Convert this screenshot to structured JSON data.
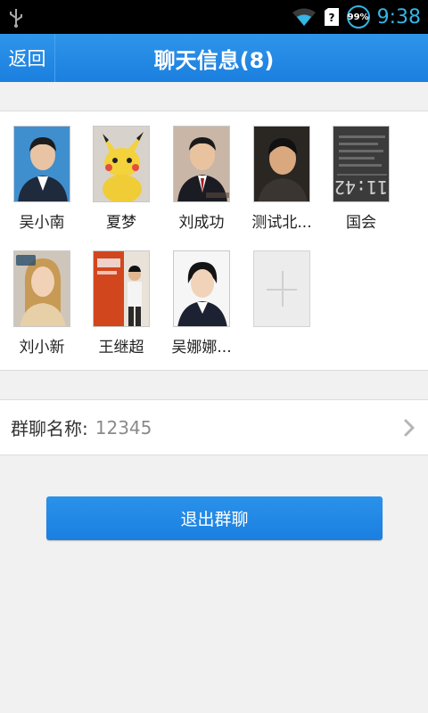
{
  "status_bar": {
    "battery": "99%",
    "time": "9:38",
    "icons": [
      "usb-icon",
      "wifi-icon",
      "sim-icon",
      "battery-icon"
    ]
  },
  "header": {
    "back_label": "返回",
    "title": "聊天信息(8)"
  },
  "members": [
    {
      "name": "吴小南",
      "avatar": "portrait-man-icon"
    },
    {
      "name": "夏梦",
      "avatar": "pikachu-plush-icon"
    },
    {
      "name": "刘成功",
      "avatar": "portrait-man-suit-icon"
    },
    {
      "name": "测试北...",
      "avatar": "portrait-man-dark-icon"
    },
    {
      "name": "国会",
      "avatar": "clock-screen-icon"
    },
    {
      "name": "刘小新",
      "avatar": "portrait-woman-icon"
    },
    {
      "name": "王继超",
      "avatar": "man-standing-icon"
    },
    {
      "name": "吴娜娜...",
      "avatar": "portrait-woman-suit-icon"
    }
  ],
  "avatar_texts": {
    "clock": "11:42"
  },
  "add_member": {
    "icon": "plus-icon"
  },
  "group_name": {
    "label": "群聊名称:",
    "value": "12345"
  },
  "exit_button_label": "退出群聊",
  "colors": {
    "header_blue": "#1e86e4",
    "status_accent": "#33b5e5",
    "background": "#f1f1f1"
  }
}
